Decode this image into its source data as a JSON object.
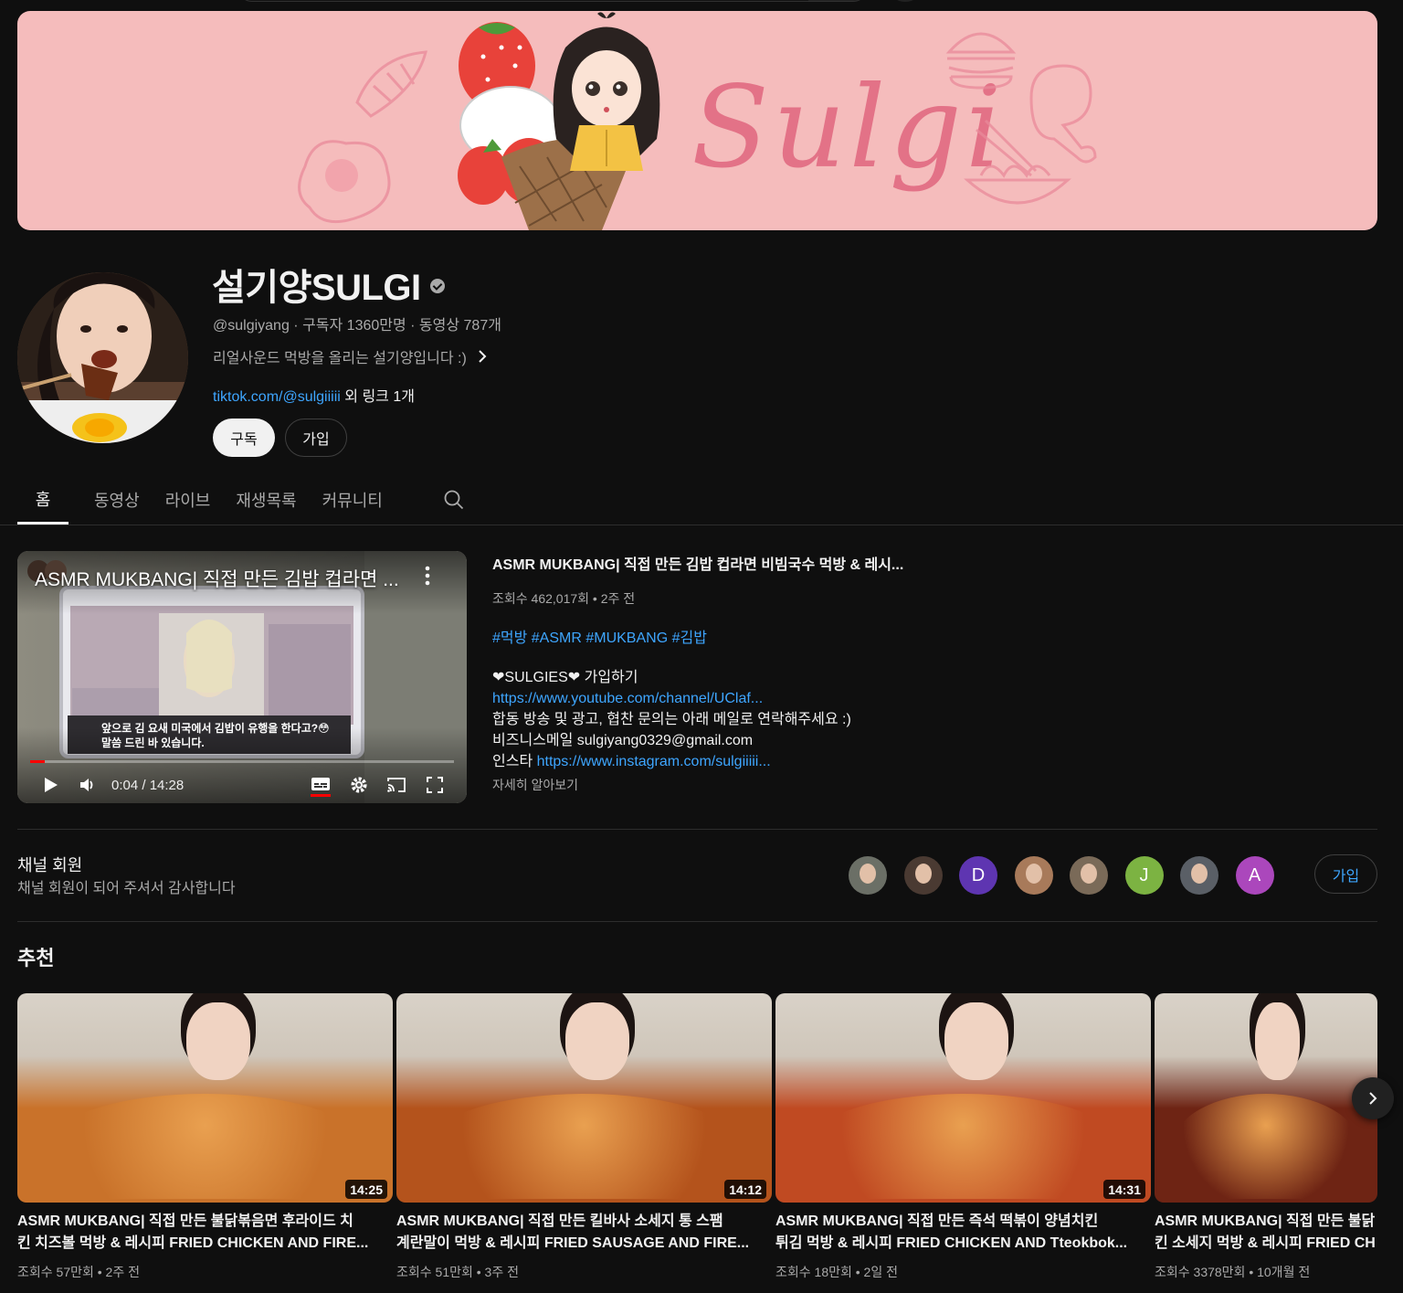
{
  "channel": {
    "name": "설기양SULGI",
    "handle": "@sulgiyang",
    "subscribers": "구독자 1360만명",
    "video_count": "동영상 787개",
    "separator": " · ",
    "description": "리얼사운드 먹방을 올리는 설기양입니다 :)",
    "link_text": "tiktok.com/@sulgiiiii",
    "link_suffix": " 외 링크 1개",
    "subscribe_label": "구독",
    "join_label": "가입",
    "banner_text": "Sulgi"
  },
  "tabs": [
    {
      "label": "홈",
      "active": true
    },
    {
      "label": "동영상"
    },
    {
      "label": "라이브"
    },
    {
      "label": "재생목록"
    },
    {
      "label": "커뮤니티"
    }
  ],
  "featured": {
    "player_title": "ASMR MUKBANG| 직접 만든 김밥 컵라면 ...",
    "player_time": "0:04 / 14:28",
    "thumb_caption": "앞으로 김 요새 미국에서 김밥이 유행을 한다고?😳",
    "thumb_caption2": "말씀 드린 바 있습니다.",
    "title": "ASMR MUKBANG| 직접 만든 김밥 컵라면 비빔국수 먹방 & 레시...",
    "meta": "조회수 462,017회 • 2주 전",
    "tags": "#먹방 #ASMR #MUKBANG #김밥",
    "desc_line1": "❤SULGIES❤ 가입하기",
    "desc_link1": "https://www.youtube.com/channel/UClaf...",
    "desc_line3": "합동 방송 및 광고, 협찬 문의는 아래 메일로 연락해주세요 :)",
    "desc_line4": "비즈니스메일 sulgiyang0329@gmail.com",
    "desc_line5_prefix": "인스타 ",
    "desc_link2": "https://www.instagram.com/sulgiiiii...",
    "more": "자세히 알아보기"
  },
  "membership": {
    "title": "채널 회원",
    "subtitle": "채널 회원이 되어 주셔서 감사합니다",
    "join_label": "가입",
    "avatars": [
      {
        "letter": "",
        "color": "#6b6f66"
      },
      {
        "letter": "",
        "color": "#4a3a32"
      },
      {
        "letter": "D",
        "color": "#5e35b1"
      },
      {
        "letter": "",
        "color": "#a87a5a"
      },
      {
        "letter": "",
        "color": "#7a6a58"
      },
      {
        "letter": "J",
        "color": "#7cb342"
      },
      {
        "letter": "",
        "color": "#5a5f66"
      },
      {
        "letter": "A",
        "color": "#ab47bc"
      }
    ]
  },
  "recommended": {
    "heading": "추천",
    "videos": [
      {
        "title_line1": "ASMR MUKBANG| 직접 만든 불닭볶음면 후라이드 치",
        "title_line2": "킨 치즈볼 먹방 & 레시피 FRIED CHICKEN AND FIRE...",
        "meta": "조회수 57만회 • 2주 전",
        "duration": "14:25",
        "bg": "#c9722a"
      },
      {
        "title_line1": "ASMR MUKBANG| 직접 만든 킬바사 소세지 통 스팸",
        "title_line2": "계란말이 먹방 & 레시피 FRIED SAUSAGE AND FIRE...",
        "meta": "조회수 51만회 • 3주 전",
        "duration": "14:12",
        "bg": "#b4531c"
      },
      {
        "title_line1": "ASMR MUKBANG| 직접 만든 즉석 떡볶이 양념치킨",
        "title_line2": "튀김 먹방 & 레시피 FRIED CHICKEN AND Tteokbok...",
        "meta": "조회수 18만회 • 2일 전",
        "duration": "14:31",
        "bg": "#c04a22"
      },
      {
        "title_line1": "ASMR MUKBANG| 직접 만든 불닭",
        "title_line2": "킨 소세지 먹방 & 레시피 FRIED CH",
        "meta": "조회수 3378만회 • 10개월 전",
        "duration": "",
        "bg": "#6e2414"
      }
    ]
  },
  "icons": {
    "search": "search-icon",
    "verified": "verified-badge-icon",
    "chevron": "chevron-right-icon",
    "next": "chevron-right-icon"
  },
  "colors": {
    "background": "#0f0f0f",
    "link": "#3ea6ff",
    "banner": "#f5bcbc",
    "banner_accent": "#e0667e"
  }
}
